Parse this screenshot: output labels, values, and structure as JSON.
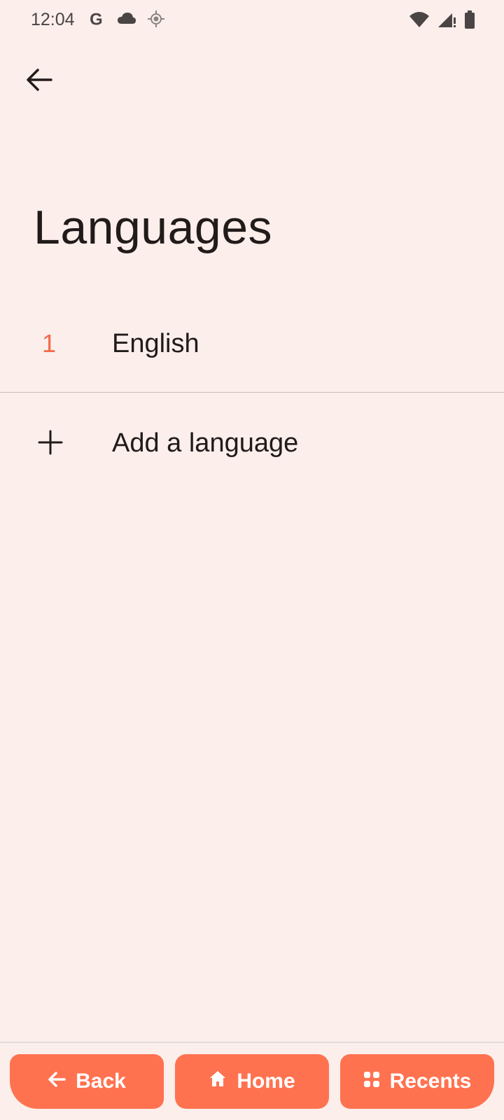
{
  "status_bar": {
    "time": "12:04",
    "left_icons": [
      "google-icon",
      "cloud-icon",
      "location-icon"
    ],
    "right_icons": [
      "wifi-icon",
      "signal-icon",
      "battery-icon"
    ]
  },
  "header": {
    "title": "Languages"
  },
  "languages": [
    {
      "index": "1",
      "name": "English"
    }
  ],
  "add_language": {
    "label": "Add a language"
  },
  "nav_bar": {
    "back_label": "Back",
    "home_label": "Home",
    "recents_label": "Recents"
  },
  "colors": {
    "background": "#fbeeeb",
    "accent": "#ff7250",
    "index_color": "#f26b4a",
    "text": "#211b1a"
  }
}
